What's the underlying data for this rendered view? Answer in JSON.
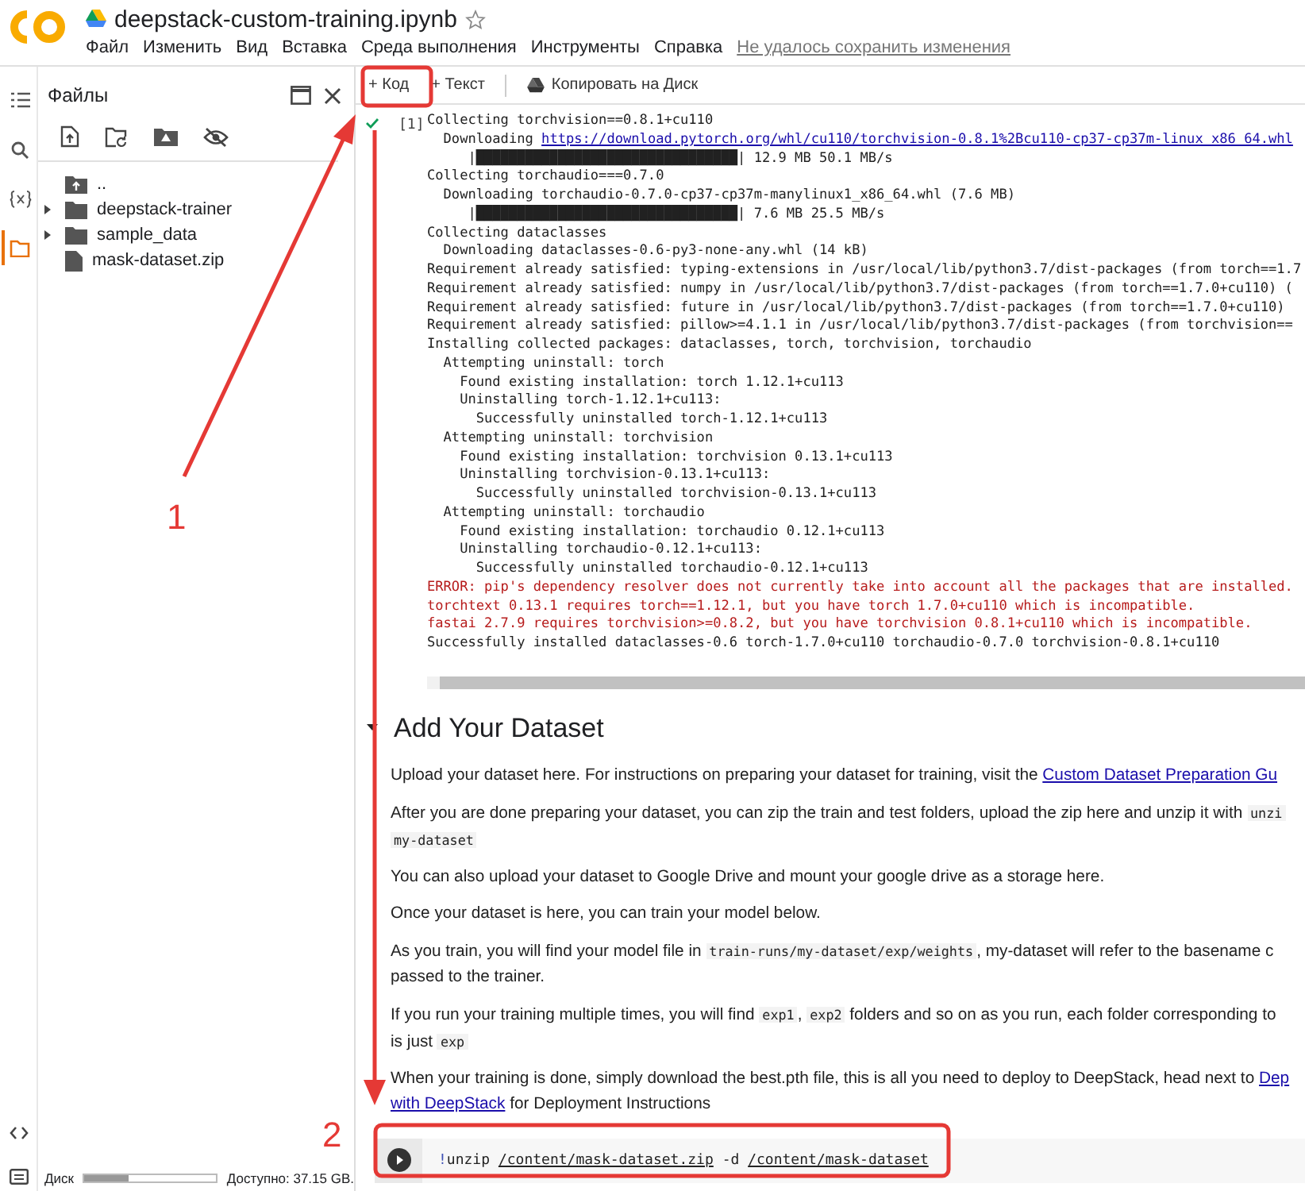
{
  "header": {
    "title": "deepstack-custom-training.ipynb",
    "starred": false,
    "menu": [
      "Файл",
      "Изменить",
      "Вид",
      "Вставка",
      "Среда выполнения",
      "Инструменты",
      "Справка"
    ],
    "save_status": "Не удалось сохранить изменения"
  },
  "rail": {
    "items": [
      {
        "selected": false
      },
      {
        "selected": false
      },
      {
        "selected": false
      },
      {
        "selected": true
      }
    ]
  },
  "files_panel": {
    "title": "Файлы",
    "tree": [
      {
        "name": "..",
        "kind": "parent"
      },
      {
        "name": "deepstack-trainer",
        "kind": "folder",
        "expanded": false
      },
      {
        "name": "sample_data",
        "kind": "folder",
        "expanded": false
      },
      {
        "name": "mask-dataset.zip",
        "kind": "file"
      }
    ],
    "disk": {
      "label": "Диск",
      "level": 0.33,
      "available": "Доступно: 37.15 GB."
    }
  },
  "toolbar": [
    {
      "label": "+ Код",
      "kind": "add"
    },
    {
      "label": "+ Текст",
      "kind": "add"
    },
    {
      "label": "Копировать на Диск",
      "kind": "drive"
    }
  ],
  "output_cell": {
    "exec_count": "[1]",
    "lines": [
      {
        "kind": "plain",
        "text": "Collecting torchvision==0.8.1+cu110"
      },
      {
        "kind": "link",
        "prefix": "  Downloading ",
        "text": "https://download.pytorch.org/whl/cu110/torchvision-0.8.1%2Bcu110-cp37-cp37m-linux_x86_64.whl"
      },
      {
        "kind": "plain",
        "text": "     |████████████████████████████████| 12.9 MB 50.1 MB/s"
      },
      {
        "kind": "plain",
        "text": "Collecting torchaudio===0.7.0"
      },
      {
        "kind": "plain",
        "text": "  Downloading torchaudio-0.7.0-cp37-cp37m-manylinux1_x86_64.whl (7.6 MB)"
      },
      {
        "kind": "plain",
        "text": "     |████████████████████████████████| 7.6 MB 25.5 MB/s"
      },
      {
        "kind": "plain",
        "text": "Collecting dataclasses"
      },
      {
        "kind": "plain",
        "text": "  Downloading dataclasses-0.6-py3-none-any.whl (14 kB)"
      },
      {
        "kind": "plain",
        "text": "Requirement already satisfied: typing-extensions in /usr/local/lib/python3.7/dist-packages (from torch==1.7"
      },
      {
        "kind": "plain",
        "text": "Requirement already satisfied: numpy in /usr/local/lib/python3.7/dist-packages (from torch==1.7.0+cu110) ("
      },
      {
        "kind": "plain",
        "text": "Requirement already satisfied: future in /usr/local/lib/python3.7/dist-packages (from torch==1.7.0+cu110)"
      },
      {
        "kind": "plain",
        "text": "Requirement already satisfied: pillow>=4.1.1 in /usr/local/lib/python3.7/dist-packages (from torchvision=="
      },
      {
        "kind": "plain",
        "text": "Installing collected packages: dataclasses, torch, torchvision, torchaudio"
      },
      {
        "kind": "plain",
        "text": "  Attempting uninstall: torch"
      },
      {
        "kind": "plain",
        "text": "    Found existing installation: torch 1.12.1+cu113"
      },
      {
        "kind": "plain",
        "text": "    Uninstalling torch-1.12.1+cu113:"
      },
      {
        "kind": "plain",
        "text": "      Successfully uninstalled torch-1.12.1+cu113"
      },
      {
        "kind": "plain",
        "text": "  Attempting uninstall: torchvision"
      },
      {
        "kind": "plain",
        "text": "    Found existing installation: torchvision 0.13.1+cu113"
      },
      {
        "kind": "plain",
        "text": "    Uninstalling torchvision-0.13.1+cu113:"
      },
      {
        "kind": "plain",
        "text": "      Successfully uninstalled torchvision-0.13.1+cu113"
      },
      {
        "kind": "plain",
        "text": "  Attempting uninstall: torchaudio"
      },
      {
        "kind": "plain",
        "text": "    Found existing installation: torchaudio 0.12.1+cu113"
      },
      {
        "kind": "plain",
        "text": "    Uninstalling torchaudio-0.12.1+cu113:"
      },
      {
        "kind": "plain",
        "text": "      Successfully uninstalled torchaudio-0.12.1+cu113"
      },
      {
        "kind": "error",
        "text": "ERROR: pip's dependency resolver does not currently take into account all the packages that are installed."
      },
      {
        "kind": "error",
        "text": "torchtext 0.13.1 requires torch==1.12.1, but you have torch 1.7.0+cu110 which is incompatible."
      },
      {
        "kind": "error",
        "text": "fastai 2.7.9 requires torchvision>=0.8.2, but you have torchvision 0.8.1+cu110 which is incompatible."
      },
      {
        "kind": "plain",
        "text": "Successfully installed dataclasses-0.6 torch-1.7.0+cu110 torchaudio-0.7.0 torchvision-0.8.1+cu110"
      }
    ]
  },
  "section": {
    "title": "Add Your Dataset",
    "expanded": true,
    "paragraphs": [
      [
        {
          "kind": "text",
          "t": "Upload your dataset here. For instructions on preparing your dataset for training, visit the "
        },
        {
          "kind": "link",
          "t": "Custom Dataset Preparation Gu"
        }
      ],
      [
        {
          "kind": "text",
          "t": "After you are done preparing your dataset, you can zip the train and test folders, upload the zip here and unzip it with "
        },
        {
          "kind": "code",
          "t": "unzi"
        },
        {
          "kind": "br"
        },
        {
          "kind": "code",
          "t": "my-dataset"
        }
      ],
      [
        {
          "kind": "text",
          "t": "You can also upload your dataset to Google Drive and mount your google drive as a storage here."
        }
      ],
      [
        {
          "kind": "text",
          "t": "Once your dataset is here, you can train your model below."
        }
      ],
      [
        {
          "kind": "text",
          "t": "As you train, you will find your model file in "
        },
        {
          "kind": "code",
          "t": "train-runs/my-dataset/exp/weights"
        },
        {
          "kind": "text",
          "t": ", my-dataset will refer to the basename c"
        },
        {
          "kind": "br"
        },
        {
          "kind": "text",
          "t": "passed to the trainer."
        }
      ],
      [
        {
          "kind": "text",
          "t": "If you run your training multiple times, you will find "
        },
        {
          "kind": "code",
          "t": "exp1"
        },
        {
          "kind": "text",
          "t": ", "
        },
        {
          "kind": "code",
          "t": "exp2"
        },
        {
          "kind": "text",
          "t": " folders and so on as you run, each folder corresponding to"
        },
        {
          "kind": "br"
        },
        {
          "kind": "text",
          "t": "is just "
        },
        {
          "kind": "code",
          "t": "exp"
        }
      ],
      [
        {
          "kind": "text",
          "t": "When your training is done, simply download the best.pth file, this is all you need to deploy to DeepStack, head next to "
        },
        {
          "kind": "link",
          "t": "Dep"
        },
        {
          "kind": "br"
        },
        {
          "kind": "link",
          "t": "with DeepStack"
        },
        {
          "kind": "text",
          "t": " for Deployment Instructions"
        }
      ]
    ]
  },
  "code_cell": {
    "code": [
      {
        "kind": "bang",
        "t": "!"
      },
      {
        "kind": "plain",
        "t": "unzip "
      },
      {
        "kind": "path",
        "t": "/content/mask-dataset.zip"
      },
      {
        "kind": "plain",
        "t": " -d "
      },
      {
        "kind": "path",
        "t": "/content/mask-dataset"
      }
    ]
  },
  "annotations": {
    "labels": [
      "1",
      "2"
    ]
  }
}
